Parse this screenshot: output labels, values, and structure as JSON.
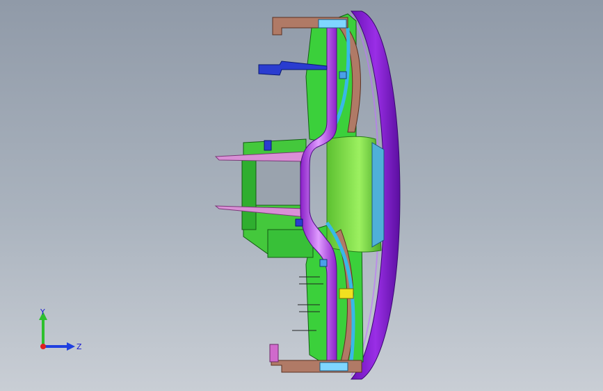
{
  "viewport": {
    "background_top": "#909aa8",
    "background_bottom": "#c9ced5"
  },
  "model": {
    "colors": {
      "rim": "#8a1fd6",
      "rim_dark": "#5b0fa0",
      "frame": "#3bd03b",
      "frame_dark": "#1f8e1f",
      "beam": "#b53ce8",
      "beam_light": "#d87cff",
      "bracket": "#b07a66",
      "duct": "#38b8e8",
      "hub": "#7fe04a",
      "hub_glass": "#4fb0d8",
      "blue_part": "#2a3cd0",
      "pink": "#d98fd6",
      "yellow": "#f0e020"
    }
  },
  "triad": {
    "y_label": "Y",
    "z_label": "Z",
    "y_color": "#2ec02e",
    "z_color": "#2040e0",
    "x_color": "#e02020"
  }
}
